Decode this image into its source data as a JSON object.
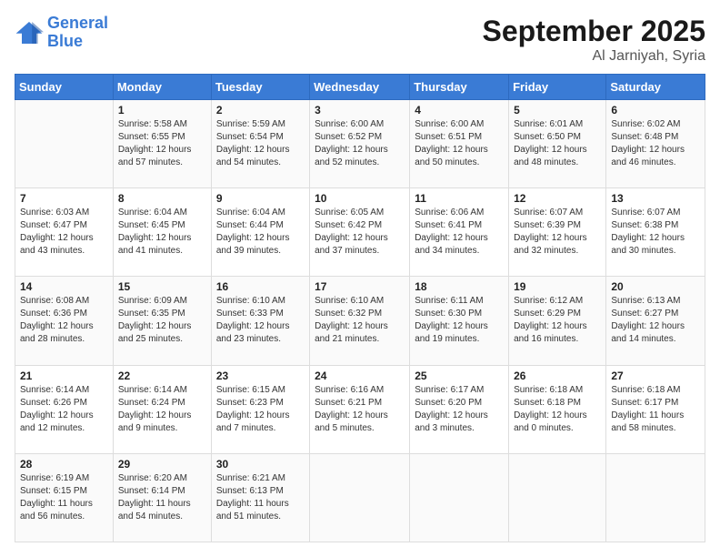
{
  "header": {
    "logo_line1": "General",
    "logo_line2": "Blue",
    "title": "September 2025",
    "subtitle": "Al Jarniyah, Syria"
  },
  "calendar": {
    "days_of_week": [
      "Sunday",
      "Monday",
      "Tuesday",
      "Wednesday",
      "Thursday",
      "Friday",
      "Saturday"
    ],
    "weeks": [
      [
        {
          "day": "",
          "sunrise": "",
          "sunset": "",
          "daylight": ""
        },
        {
          "day": "1",
          "sunrise": "Sunrise: 5:58 AM",
          "sunset": "Sunset: 6:55 PM",
          "daylight": "Daylight: 12 hours and 57 minutes."
        },
        {
          "day": "2",
          "sunrise": "Sunrise: 5:59 AM",
          "sunset": "Sunset: 6:54 PM",
          "daylight": "Daylight: 12 hours and 54 minutes."
        },
        {
          "day": "3",
          "sunrise": "Sunrise: 6:00 AM",
          "sunset": "Sunset: 6:52 PM",
          "daylight": "Daylight: 12 hours and 52 minutes."
        },
        {
          "day": "4",
          "sunrise": "Sunrise: 6:00 AM",
          "sunset": "Sunset: 6:51 PM",
          "daylight": "Daylight: 12 hours and 50 minutes."
        },
        {
          "day": "5",
          "sunrise": "Sunrise: 6:01 AM",
          "sunset": "Sunset: 6:50 PM",
          "daylight": "Daylight: 12 hours and 48 minutes."
        },
        {
          "day": "6",
          "sunrise": "Sunrise: 6:02 AM",
          "sunset": "Sunset: 6:48 PM",
          "daylight": "Daylight: 12 hours and 46 minutes."
        }
      ],
      [
        {
          "day": "7",
          "sunrise": "Sunrise: 6:03 AM",
          "sunset": "Sunset: 6:47 PM",
          "daylight": "Daylight: 12 hours and 43 minutes."
        },
        {
          "day": "8",
          "sunrise": "Sunrise: 6:04 AM",
          "sunset": "Sunset: 6:45 PM",
          "daylight": "Daylight: 12 hours and 41 minutes."
        },
        {
          "day": "9",
          "sunrise": "Sunrise: 6:04 AM",
          "sunset": "Sunset: 6:44 PM",
          "daylight": "Daylight: 12 hours and 39 minutes."
        },
        {
          "day": "10",
          "sunrise": "Sunrise: 6:05 AM",
          "sunset": "Sunset: 6:42 PM",
          "daylight": "Daylight: 12 hours and 37 minutes."
        },
        {
          "day": "11",
          "sunrise": "Sunrise: 6:06 AM",
          "sunset": "Sunset: 6:41 PM",
          "daylight": "Daylight: 12 hours and 34 minutes."
        },
        {
          "day": "12",
          "sunrise": "Sunrise: 6:07 AM",
          "sunset": "Sunset: 6:39 PM",
          "daylight": "Daylight: 12 hours and 32 minutes."
        },
        {
          "day": "13",
          "sunrise": "Sunrise: 6:07 AM",
          "sunset": "Sunset: 6:38 PM",
          "daylight": "Daylight: 12 hours and 30 minutes."
        }
      ],
      [
        {
          "day": "14",
          "sunrise": "Sunrise: 6:08 AM",
          "sunset": "Sunset: 6:36 PM",
          "daylight": "Daylight: 12 hours and 28 minutes."
        },
        {
          "day": "15",
          "sunrise": "Sunrise: 6:09 AM",
          "sunset": "Sunset: 6:35 PM",
          "daylight": "Daylight: 12 hours and 25 minutes."
        },
        {
          "day": "16",
          "sunrise": "Sunrise: 6:10 AM",
          "sunset": "Sunset: 6:33 PM",
          "daylight": "Daylight: 12 hours and 23 minutes."
        },
        {
          "day": "17",
          "sunrise": "Sunrise: 6:10 AM",
          "sunset": "Sunset: 6:32 PM",
          "daylight": "Daylight: 12 hours and 21 minutes."
        },
        {
          "day": "18",
          "sunrise": "Sunrise: 6:11 AM",
          "sunset": "Sunset: 6:30 PM",
          "daylight": "Daylight: 12 hours and 19 minutes."
        },
        {
          "day": "19",
          "sunrise": "Sunrise: 6:12 AM",
          "sunset": "Sunset: 6:29 PM",
          "daylight": "Daylight: 12 hours and 16 minutes."
        },
        {
          "day": "20",
          "sunrise": "Sunrise: 6:13 AM",
          "sunset": "Sunset: 6:27 PM",
          "daylight": "Daylight: 12 hours and 14 minutes."
        }
      ],
      [
        {
          "day": "21",
          "sunrise": "Sunrise: 6:14 AM",
          "sunset": "Sunset: 6:26 PM",
          "daylight": "Daylight: 12 hours and 12 minutes."
        },
        {
          "day": "22",
          "sunrise": "Sunrise: 6:14 AM",
          "sunset": "Sunset: 6:24 PM",
          "daylight": "Daylight: 12 hours and 9 minutes."
        },
        {
          "day": "23",
          "sunrise": "Sunrise: 6:15 AM",
          "sunset": "Sunset: 6:23 PM",
          "daylight": "Daylight: 12 hours and 7 minutes."
        },
        {
          "day": "24",
          "sunrise": "Sunrise: 6:16 AM",
          "sunset": "Sunset: 6:21 PM",
          "daylight": "Daylight: 12 hours and 5 minutes."
        },
        {
          "day": "25",
          "sunrise": "Sunrise: 6:17 AM",
          "sunset": "Sunset: 6:20 PM",
          "daylight": "Daylight: 12 hours and 3 minutes."
        },
        {
          "day": "26",
          "sunrise": "Sunrise: 6:18 AM",
          "sunset": "Sunset: 6:18 PM",
          "daylight": "Daylight: 12 hours and 0 minutes."
        },
        {
          "day": "27",
          "sunrise": "Sunrise: 6:18 AM",
          "sunset": "Sunset: 6:17 PM",
          "daylight": "Daylight: 11 hours and 58 minutes."
        }
      ],
      [
        {
          "day": "28",
          "sunrise": "Sunrise: 6:19 AM",
          "sunset": "Sunset: 6:15 PM",
          "daylight": "Daylight: 11 hours and 56 minutes."
        },
        {
          "day": "29",
          "sunrise": "Sunrise: 6:20 AM",
          "sunset": "Sunset: 6:14 PM",
          "daylight": "Daylight: 11 hours and 54 minutes."
        },
        {
          "day": "30",
          "sunrise": "Sunrise: 6:21 AM",
          "sunset": "Sunset: 6:13 PM",
          "daylight": "Daylight: 11 hours and 51 minutes."
        },
        {
          "day": "",
          "sunrise": "",
          "sunset": "",
          "daylight": ""
        },
        {
          "day": "",
          "sunrise": "",
          "sunset": "",
          "daylight": ""
        },
        {
          "day": "",
          "sunrise": "",
          "sunset": "",
          "daylight": ""
        },
        {
          "day": "",
          "sunrise": "",
          "sunset": "",
          "daylight": ""
        }
      ]
    ]
  }
}
